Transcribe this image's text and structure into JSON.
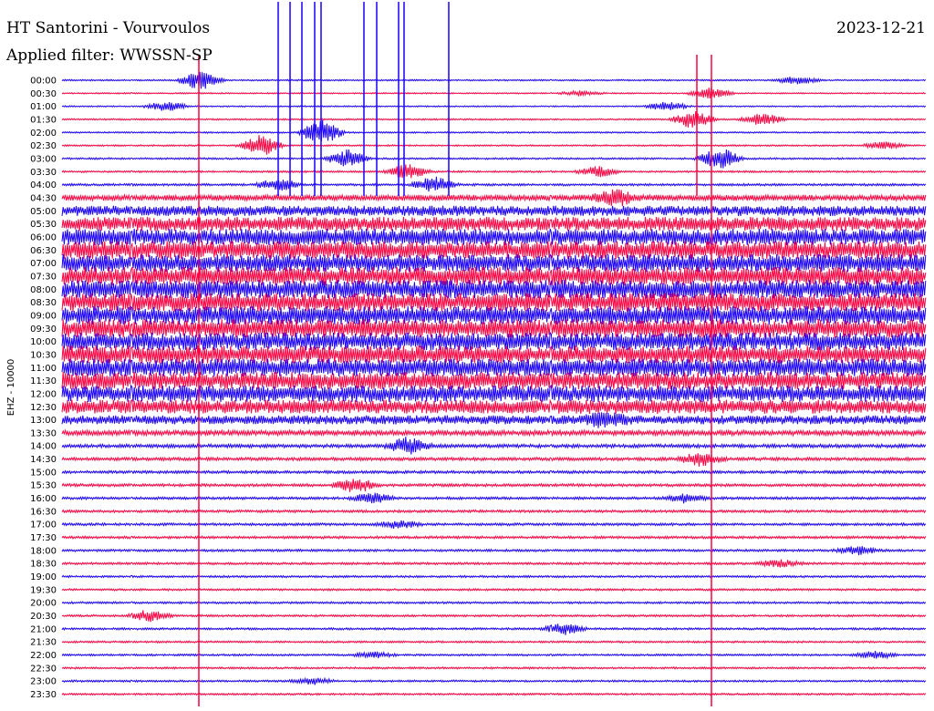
{
  "header": {
    "station": "HT Santorini - Vourvoulos",
    "filter": "Applied filter: WWSSN-SP",
    "date": "2023-12-21"
  },
  "chart_data": {
    "type": "line",
    "title": "HT Santorini - Vourvoulos",
    "subtitle": "Applied filter: WWSSN-SP",
    "date": "2023-12-21",
    "ylabel": "EHZ - 10000",
    "xlabel": "",
    "row_labels": [
      "00:00",
      "00:30",
      "01:00",
      "01:30",
      "02:00",
      "02:30",
      "03:00",
      "03:30",
      "04:00",
      "04:30",
      "05:00",
      "05:30",
      "06:00",
      "06:30",
      "07:00",
      "07:30",
      "08:00",
      "08:30",
      "09:00",
      "09:30",
      "10:00",
      "10:30",
      "11:00",
      "11:30",
      "12:00",
      "12:30",
      "13:00",
      "13:30",
      "14:00",
      "14:30",
      "15:00",
      "15:30",
      "16:00",
      "16:30",
      "17:00",
      "17:30",
      "18:00",
      "18:30",
      "19:00",
      "19:30",
      "20:00",
      "20:30",
      "21:00",
      "21:30",
      "22:00",
      "22:30",
      "23:00",
      "23:30"
    ],
    "trace_colors": [
      "#1a00ff",
      "#ff0040"
    ],
    "series": [
      {
        "label": "00:00",
        "noise": 0.12,
        "events": [
          {
            "t": 0.16,
            "a": 1.6
          },
          {
            "t": 0.85,
            "a": 0.6
          }
        ]
      },
      {
        "label": "00:30",
        "noise": 0.1,
        "events": [
          {
            "t": 0.6,
            "a": 0.4
          },
          {
            "t": 0.75,
            "a": 0.9
          }
        ]
      },
      {
        "label": "01:00",
        "noise": 0.1,
        "events": [
          {
            "t": 0.12,
            "a": 0.8
          },
          {
            "t": 0.7,
            "a": 0.7
          }
        ]
      },
      {
        "label": "01:30",
        "noise": 0.12,
        "events": [
          {
            "t": 0.73,
            "a": 1.5
          },
          {
            "t": 0.81,
            "a": 1.0
          }
        ]
      },
      {
        "label": "02:00",
        "noise": 0.12,
        "events": [
          {
            "t": 0.3,
            "a": 2.0
          }
        ]
      },
      {
        "label": "02:30",
        "noise": 0.12,
        "events": [
          {
            "t": 0.23,
            "a": 1.7
          },
          {
            "t": 0.95,
            "a": 0.6
          }
        ]
      },
      {
        "label": "03:00",
        "noise": 0.14,
        "events": [
          {
            "t": 0.33,
            "a": 1.4
          },
          {
            "t": 0.76,
            "a": 1.8
          }
        ]
      },
      {
        "label": "03:30",
        "noise": 0.14,
        "events": [
          {
            "t": 0.4,
            "a": 1.2
          },
          {
            "t": 0.62,
            "a": 0.8
          }
        ]
      },
      {
        "label": "04:00",
        "noise": 0.18,
        "events": [
          {
            "t": 0.25,
            "a": 1.0
          },
          {
            "t": 0.43,
            "a": 1.3
          }
        ]
      },
      {
        "label": "04:30",
        "noise": 0.45,
        "events": [
          {
            "t": 0.64,
            "a": 1.2
          }
        ]
      },
      {
        "label": "05:00",
        "noise": 0.8,
        "events": []
      },
      {
        "label": "05:30",
        "noise": 1.1,
        "events": []
      },
      {
        "label": "06:00",
        "noise": 1.3,
        "events": []
      },
      {
        "label": "06:30",
        "noise": 1.4,
        "events": []
      },
      {
        "label": "07:00",
        "noise": 1.4,
        "events": []
      },
      {
        "label": "07:30",
        "noise": 1.45,
        "events": []
      },
      {
        "label": "08:00",
        "noise": 1.45,
        "events": []
      },
      {
        "label": "08:30",
        "noise": 1.45,
        "events": []
      },
      {
        "label": "09:00",
        "noise": 1.45,
        "events": []
      },
      {
        "label": "09:30",
        "noise": 1.45,
        "events": []
      },
      {
        "label": "10:00",
        "noise": 1.4,
        "events": []
      },
      {
        "label": "10:30",
        "noise": 1.4,
        "events": []
      },
      {
        "label": "11:00",
        "noise": 1.4,
        "events": []
      },
      {
        "label": "11:30",
        "noise": 1.35,
        "events": []
      },
      {
        "label": "12:00",
        "noise": 1.3,
        "events": []
      },
      {
        "label": "12:30",
        "noise": 1.1,
        "events": []
      },
      {
        "label": "13:00",
        "noise": 0.7,
        "events": [
          {
            "t": 0.63,
            "a": 1.0
          }
        ]
      },
      {
        "label": "13:30",
        "noise": 0.4,
        "events": []
      },
      {
        "label": "14:00",
        "noise": 0.28,
        "events": [
          {
            "t": 0.4,
            "a": 1.3
          }
        ]
      },
      {
        "label": "14:30",
        "noise": 0.25,
        "events": [
          {
            "t": 0.74,
            "a": 1.1
          }
        ]
      },
      {
        "label": "15:00",
        "noise": 0.22,
        "events": []
      },
      {
        "label": "15:30",
        "noise": 0.22,
        "events": [
          {
            "t": 0.34,
            "a": 1.2
          }
        ]
      },
      {
        "label": "16:00",
        "noise": 0.2,
        "events": [
          {
            "t": 0.36,
            "a": 0.9
          },
          {
            "t": 0.72,
            "a": 0.7
          }
        ]
      },
      {
        "label": "16:30",
        "noise": 0.2,
        "events": []
      },
      {
        "label": "17:00",
        "noise": 0.2,
        "events": [
          {
            "t": 0.39,
            "a": 0.6
          }
        ]
      },
      {
        "label": "17:30",
        "noise": 0.2,
        "events": []
      },
      {
        "label": "18:00",
        "noise": 0.18,
        "events": [
          {
            "t": 0.92,
            "a": 0.6
          }
        ]
      },
      {
        "label": "18:30",
        "noise": 0.18,
        "events": [
          {
            "t": 0.83,
            "a": 0.6
          }
        ]
      },
      {
        "label": "19:00",
        "noise": 0.16,
        "events": []
      },
      {
        "label": "19:30",
        "noise": 0.16,
        "events": []
      },
      {
        "label": "20:00",
        "noise": 0.16,
        "events": []
      },
      {
        "label": "20:30",
        "noise": 0.16,
        "events": [
          {
            "t": 0.1,
            "a": 0.9
          }
        ]
      },
      {
        "label": "21:00",
        "noise": 0.16,
        "events": [
          {
            "t": 0.58,
            "a": 0.9
          }
        ]
      },
      {
        "label": "21:30",
        "noise": 0.15,
        "events": []
      },
      {
        "label": "22:00",
        "noise": 0.15,
        "events": [
          {
            "t": 0.36,
            "a": 0.5
          },
          {
            "t": 0.94,
            "a": 0.6
          }
        ]
      },
      {
        "label": "22:30",
        "noise": 0.15,
        "events": []
      },
      {
        "label": "23:00",
        "noise": 0.15,
        "events": [
          {
            "t": 0.29,
            "a": 0.5
          }
        ]
      },
      {
        "label": "23:30",
        "noise": 0.15,
        "events": []
      }
    ],
    "spikes": [
      {
        "t": 0.22,
        "from": "00:00",
        "to": "00:00",
        "a": 1.0
      },
      {
        "t": 0.74,
        "from": "00:00",
        "to": "00:00",
        "a": 1.0
      }
    ],
    "grid": false,
    "legend": "none"
  }
}
